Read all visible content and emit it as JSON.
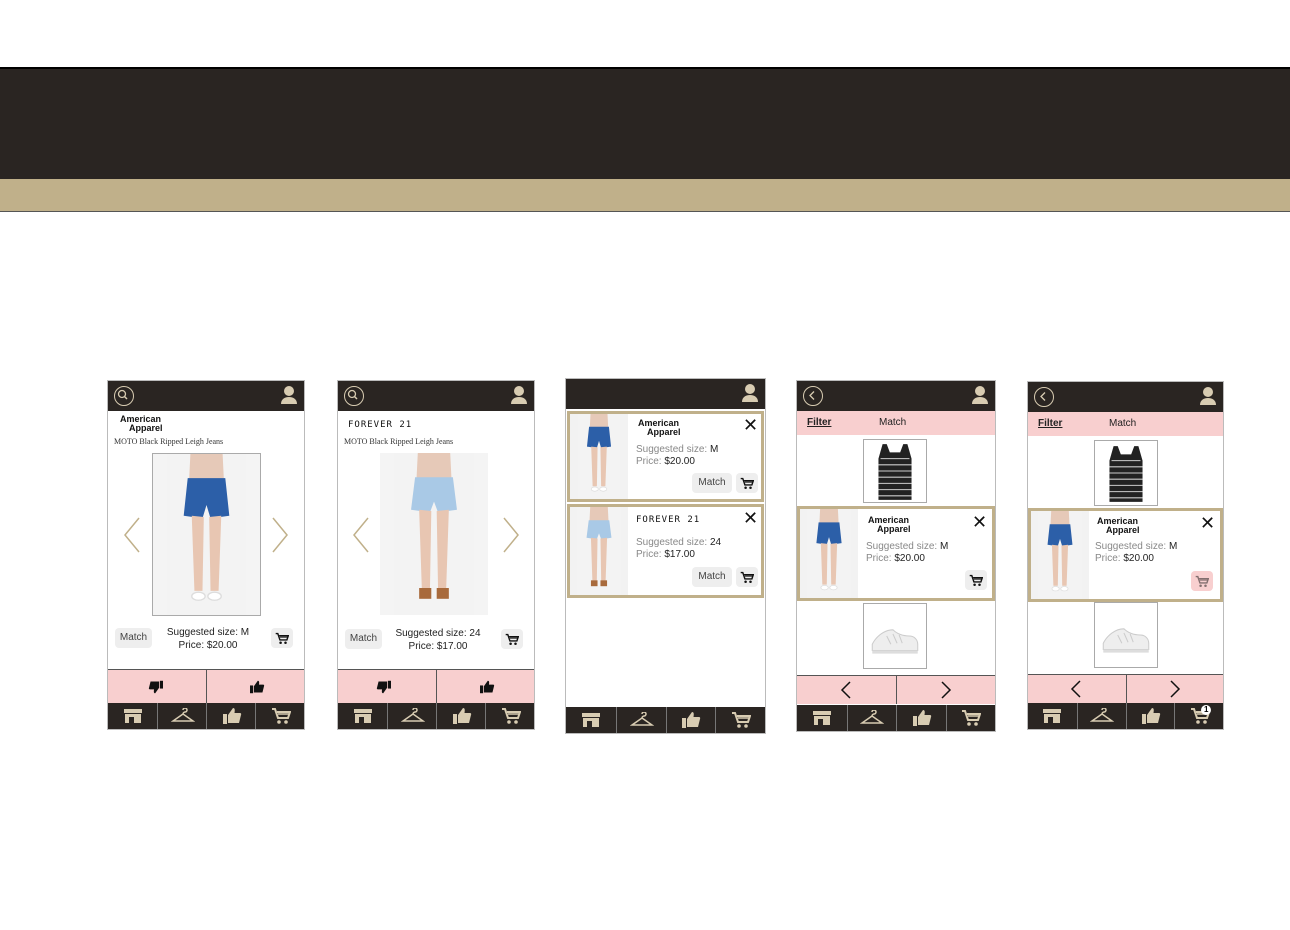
{
  "screen1": {
    "brand_line1": "American",
    "brand_line2": "Apparel",
    "product_name": "MOTO Black Ripped Leigh Jeans",
    "match_label": "Match",
    "size_label": "Suggested size:",
    "size_value": "M",
    "price_label": "Price:",
    "price_value": "$20.00"
  },
  "screen2": {
    "brand": "FOREVER 21",
    "product_name": "MOTO Black Ripped Leigh Jeans",
    "match_label": "Match",
    "size_label": "Suggested size:",
    "size_value": "24",
    "price_label": "Price:",
    "price_value": "$17.00"
  },
  "screen3": {
    "items": [
      {
        "brand_line1": "American",
        "brand_line2": "Apparel",
        "size_label": "Suggested size:",
        "size_value": "M",
        "price_label": "Price:",
        "price_value": "$20.00",
        "match_label": "Match"
      },
      {
        "brand": "FOREVER 21",
        "size_label": "Suggested size:",
        "size_value": "24",
        "price_label": "Price:",
        "price_value": "$17.00",
        "match_label": "Match"
      }
    ]
  },
  "screen4": {
    "filter_label": "Filter",
    "title": "Match",
    "item": {
      "brand_line1": "American",
      "brand_line2": "Apparel",
      "size_label": "Suggested size:",
      "size_value": "M",
      "price_label": "Price:",
      "price_value": "$20.00"
    }
  },
  "screen5": {
    "filter_label": "Filter",
    "title": "Match",
    "item": {
      "brand_line1": "American",
      "brand_line2": "Apparel",
      "size_label": "Suggested size:",
      "size_value": "M",
      "price_label": "Price:",
      "price_value": "$20.00"
    },
    "cart_badge": "1"
  },
  "icons": {
    "search": "search-icon",
    "user": "user-icon",
    "back": "back-icon",
    "store": "store-icon",
    "hanger": "hanger-icon",
    "thumb_up": "thumbs-up-icon",
    "thumb_down": "thumbs-down-icon",
    "cart": "cart-icon",
    "close": "close-icon"
  },
  "colors": {
    "dark": "#2a2522",
    "gold": "#c0b08a",
    "pink": "#f8cfcf"
  }
}
